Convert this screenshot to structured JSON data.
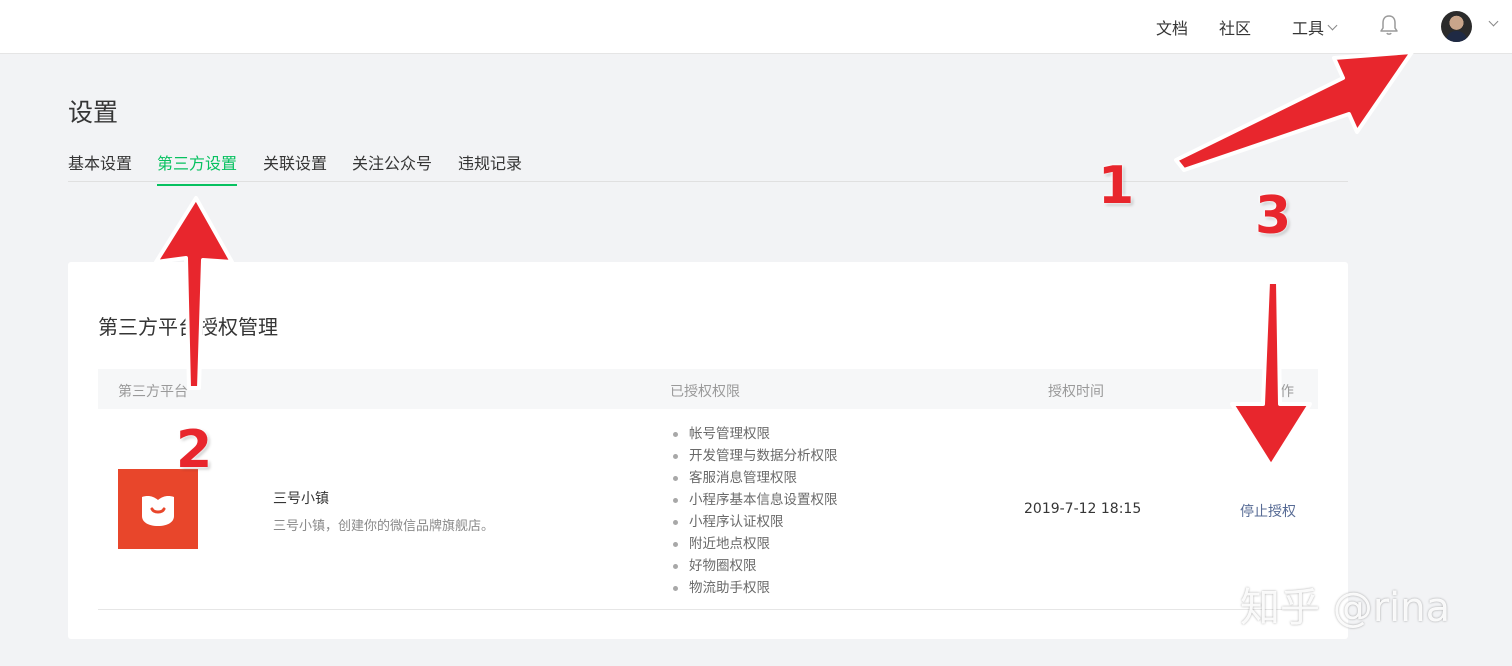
{
  "topbar": {
    "docs": "文档",
    "community": "社区",
    "tools": "工具",
    "icons": [
      "chevron-down-icon",
      "bell-icon",
      "avatar",
      "chevron-down-icon"
    ]
  },
  "page": {
    "title": "设置",
    "tabs": [
      "基本设置",
      "第三方设置",
      "关联设置",
      "关注公众号",
      "违规记录"
    ],
    "active_tab": "第三方设置",
    "accent_color": "#07c160"
  },
  "card": {
    "title": "第三方平台授权管理",
    "columns": [
      "第三方平台",
      "已授权权限",
      "授权时间",
      "操作"
    ],
    "rows": [
      {
        "logo_icon": "open-box-icon",
        "logo_color": "#e8462b",
        "name": "三号小镇",
        "description": "三号小镇，创建你的微信品牌旗舰店。",
        "permissions": [
          "帐号管理权限",
          "开发管理与数据分析权限",
          "客服消息管理权限",
          "小程序基本信息设置权限",
          "小程序认证权限",
          "附近地点权限",
          "好物圈权限",
          "物流助手权限"
        ],
        "auth_time": "2019-7-12 18:15",
        "action": "停止授权"
      }
    ]
  },
  "annotations": {
    "labels": [
      "1",
      "2",
      "3"
    ],
    "arrow_color": "#e8262d"
  },
  "watermark": "知乎 @rina"
}
